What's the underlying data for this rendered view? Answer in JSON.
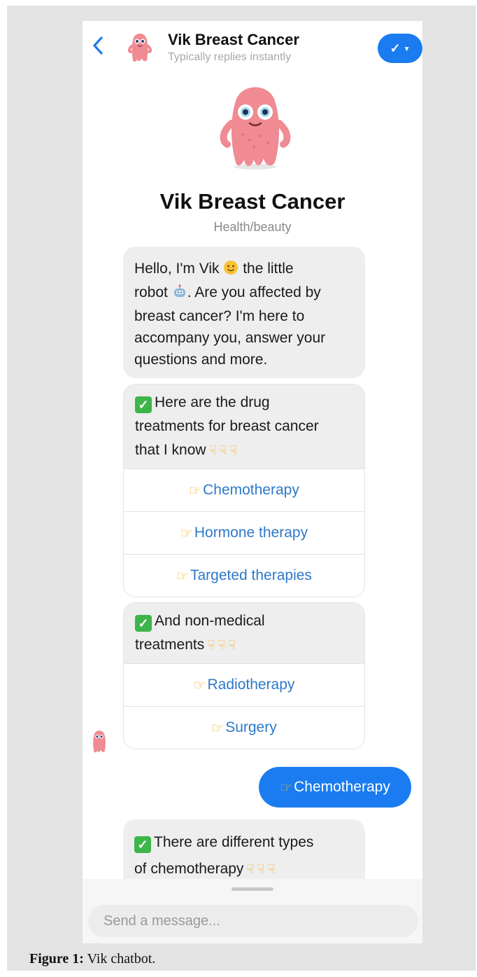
{
  "header": {
    "title": "Vik Breast Cancer",
    "subtitle": "Typically replies instantly",
    "menu_icon": "check-icon"
  },
  "profile": {
    "name": "Vik Breast Cancer",
    "category": "Health/beauty"
  },
  "messages": {
    "intro": {
      "line1_a": "Hello, I'm Vik",
      "line1_b": "the little",
      "line2_a": "robot",
      "line2_b": ". Are you affected by",
      "line3": "breast cancer? I'm here to",
      "line4": "accompany you, answer your",
      "line5": "questions and more."
    },
    "drug_card": {
      "line1": "Here are the drug",
      "line2": "treatments for breast cancer",
      "line3": "that I know",
      "buttons": [
        "Chemotherapy",
        "Hormone therapy",
        "Targeted therapies"
      ]
    },
    "nonmed_card": {
      "line1": "And non-medical",
      "line2": "treatments",
      "buttons": [
        "Radiotherapy",
        "Surgery"
      ]
    },
    "user_reply": "Chemotherapy",
    "types_msg": {
      "line1": "There are different types",
      "line2": "of chemotherapy"
    }
  },
  "composer": {
    "placeholder": "Send a message..."
  },
  "caption": {
    "label": "Figure 1:",
    "text": "Vik chatbot."
  },
  "colors": {
    "accent": "#1a7cf0",
    "link": "#2d79c9",
    "bubble": "#eeeeef",
    "mascot": "#f08a93"
  }
}
